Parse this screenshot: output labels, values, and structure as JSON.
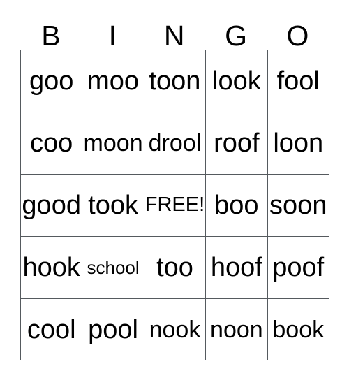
{
  "card": {
    "headers": [
      "B",
      "I",
      "N",
      "G",
      "O"
    ],
    "rows": [
      [
        {
          "text": "goo",
          "size": "lg"
        },
        {
          "text": "moo",
          "size": "lg"
        },
        {
          "text": "toon",
          "size": "lg"
        },
        {
          "text": "look",
          "size": "lg"
        },
        {
          "text": "fool",
          "size": "lg"
        }
      ],
      [
        {
          "text": "coo",
          "size": "lg"
        },
        {
          "text": "moon",
          "size": "md"
        },
        {
          "text": "drool",
          "size": "md"
        },
        {
          "text": "roof",
          "size": "lg"
        },
        {
          "text": "loon",
          "size": "lg"
        }
      ],
      [
        {
          "text": "good",
          "size": "lg"
        },
        {
          "text": "took",
          "size": "lg"
        },
        {
          "text": "FREE!",
          "size": "sm"
        },
        {
          "text": "boo",
          "size": "lg"
        },
        {
          "text": "soon",
          "size": "lg"
        }
      ],
      [
        {
          "text": "hook",
          "size": "lg"
        },
        {
          "text": "school",
          "size": "xs"
        },
        {
          "text": "too",
          "size": "lg"
        },
        {
          "text": "hoof",
          "size": "lg"
        },
        {
          "text": "poof",
          "size": "lg"
        }
      ],
      [
        {
          "text": "cool",
          "size": "lg"
        },
        {
          "text": "pool",
          "size": "lg"
        },
        {
          "text": "nook",
          "size": "md"
        },
        {
          "text": "noon",
          "size": "md"
        },
        {
          "text": "book",
          "size": "md"
        }
      ]
    ],
    "colors": {
      "text": "#000000",
      "border": "#555a5e",
      "background": "#ffffff"
    }
  }
}
